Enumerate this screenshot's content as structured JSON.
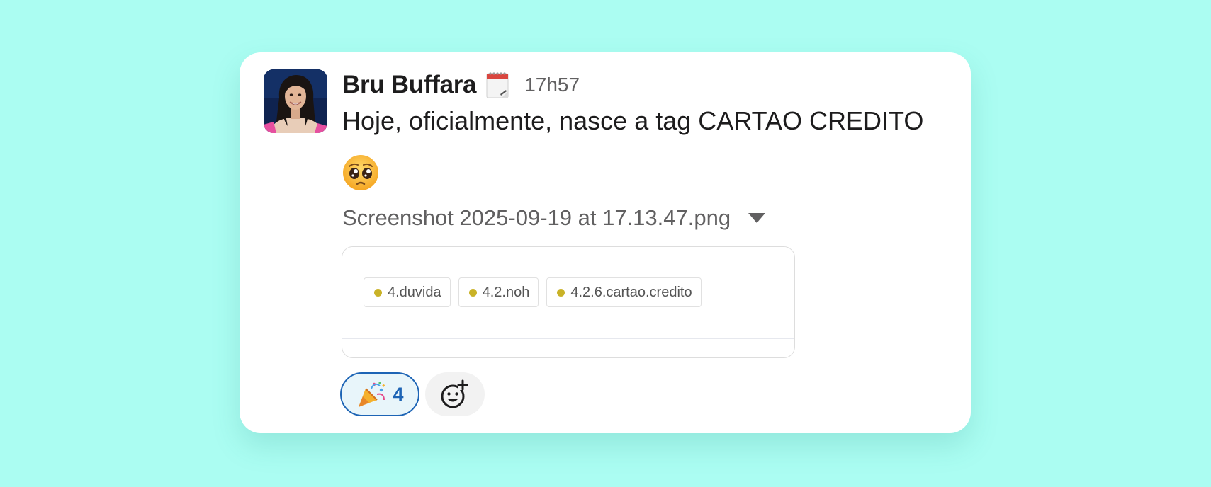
{
  "message": {
    "author": "Bru Buffara",
    "status_icon": "calendar-notepad-icon",
    "timestamp": "17h57",
    "text": "Hoje, oficialmente, nasce a tag CARTAO CREDITO",
    "emoji": "pleading-face-emoji"
  },
  "attachment": {
    "file_name": "Screenshot 2025-09-19 at 17.13.47.png",
    "tags": [
      {
        "label": "4.duvida"
      },
      {
        "label": "4.2.noh"
      },
      {
        "label": "4.2.6.cartao.credito"
      }
    ],
    "tag_dot_color": "#c9b227"
  },
  "reactions": [
    {
      "emoji": "party-popper-emoji",
      "count": "4"
    }
  ],
  "add_reaction_icon": "add-emoji-icon",
  "colors": {
    "background": "#abfdf2",
    "card": "#ffffff",
    "reaction_border": "#1d64b5",
    "reaction_bg": "#e8f5fa"
  }
}
